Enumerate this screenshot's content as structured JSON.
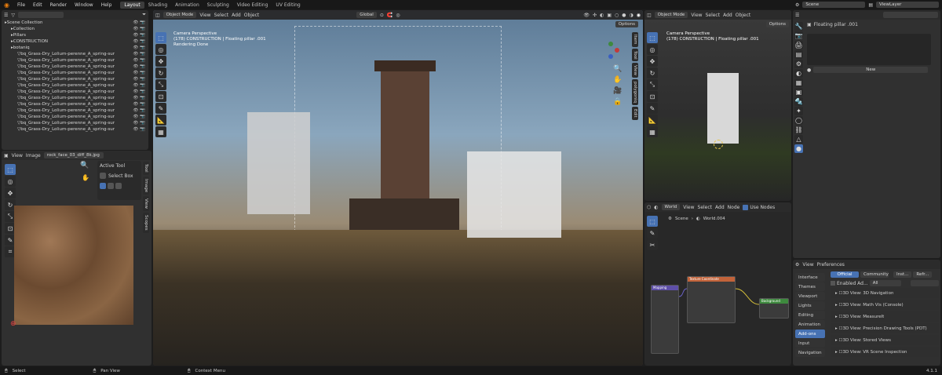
{
  "menu": [
    "File",
    "Edit",
    "Render",
    "Window",
    "Help"
  ],
  "workspaces": {
    "tabs": [
      "Layout",
      "Shading",
      "Animation",
      "Sculpting",
      "Video Editing",
      "UV Editing"
    ],
    "active_index": 0
  },
  "scene_field": "Scene",
  "viewlayer_field": "ViewLayer",
  "outliner": {
    "search_placeholder": "",
    "rows": [
      {
        "label": "Scene Collection",
        "indent": 0
      },
      {
        "label": "Collection",
        "indent": 1
      },
      {
        "label": "Pillars",
        "indent": 1
      },
      {
        "label": "CONSTRUCTION",
        "indent": 1
      },
      {
        "label": "botaniq",
        "indent": 1
      },
      {
        "label": "bq_Grass-Dry_Lolium-perenne_A_spring-summer",
        "indent": 2
      },
      {
        "label": "bq_Grass-Dry_Lolium-perenne_A_spring-summer",
        "indent": 2
      },
      {
        "label": "bq_Grass-Dry_Lolium-perenne_A_spring-summer",
        "indent": 2
      },
      {
        "label": "bq_Grass-Dry_Lolium-perenne_A_spring-summer",
        "indent": 2
      },
      {
        "label": "bq_Grass-Dry_Lolium-perenne_A_spring-summer",
        "indent": 2
      },
      {
        "label": "bq_Grass-Dry_Lolium-perenne_A_spring-summer",
        "indent": 2
      },
      {
        "label": "bq_Grass-Dry_Lolium-perenne_A_spring-summer",
        "indent": 2
      },
      {
        "label": "bq_Grass-Dry_Lolium-perenne_A_spring-summer",
        "indent": 2
      },
      {
        "label": "bq_Grass-Dry_Lolium-perenne_A_spring-summer",
        "indent": 2
      },
      {
        "label": "bq_Grass-Dry_Lolium-perenne_A_spring-summer",
        "indent": 2
      },
      {
        "label": "bq_Grass-Dry_Lolium-perenne_A_spring-summer",
        "indent": 2
      },
      {
        "label": "bq_Grass-Dry_Lolium-perenne_A_spring-summer",
        "indent": 2
      },
      {
        "label": "bq_Grass-Dry_Lolium-perenne_A_spring-summer",
        "indent": 2
      }
    ]
  },
  "image_editor": {
    "menus": [
      "View",
      "Image"
    ],
    "image_name": "rock_face_03_diff_8k.jpg",
    "active_tool_title": "Active Tool",
    "active_tool_name": "Select Box",
    "side_tabs": [
      "Tool",
      "Image",
      "View",
      "Scopes"
    ]
  },
  "viewport_main": {
    "mode": "Object Mode",
    "menus": [
      "View",
      "Select",
      "Add",
      "Object"
    ],
    "transform": "Global",
    "options": "Options",
    "overlay_line1": "Camera Perspective",
    "overlay_line2": "(178) CONSTRUCTION | Floating pillar .001",
    "overlay_line3": "Rendering Done",
    "side_tabs": [
      "Item",
      "Tool",
      "View",
      "polygoniq",
      "Edit"
    ]
  },
  "viewport_right": {
    "mode": "Object Mode",
    "menus": [
      "View",
      "Select",
      "Add",
      "Object"
    ],
    "options": "Options",
    "overlay_line1": "Camera Perspective",
    "overlay_line2": "(178) CONSTRUCTION | Floating pillar .001"
  },
  "node_editor": {
    "type": "World",
    "menus": [
      "View",
      "Select",
      "Add",
      "Node"
    ],
    "use_nodes": "Use Nodes",
    "breadcrumb_scene": "Scene",
    "breadcrumb_world": "World.004",
    "nodes": [
      {
        "title": "Mapping"
      },
      {
        "title": "Texture Coordinate"
      },
      {
        "title": "Background"
      }
    ]
  },
  "properties": {
    "object_name": "Floating pillar .001",
    "new_button": "New"
  },
  "preferences": {
    "menus": [
      "View",
      "Preferences"
    ],
    "categories": [
      "Interface",
      "Themes",
      "Viewport",
      "Lights",
      "Editing",
      "Animation",
      "Add-ons",
      "Input",
      "Navigation"
    ],
    "active_category": "Add-ons",
    "tabs": [
      "Official",
      "Community"
    ],
    "install": "Inst...",
    "refresh": "Refr...",
    "enabled_addons": "Enabled Ad...",
    "filter_all": "All",
    "addons": [
      "3D View: 3D Navigation",
      "3D View: Math Vis (Console)",
      "3D View: MeasureIt",
      "3D View: Precision Drawing Tools (PDT)",
      "3D View: Stored Views",
      "3D View: VR Scene Inspection"
    ]
  },
  "statusbar": {
    "select": "Select",
    "pan": "Pan View",
    "context": "Context Menu",
    "version": "4.1.1"
  },
  "colors": {
    "accent": "#4772b3",
    "panel": "#303030",
    "header": "#2b2b2b",
    "background": "#1d1d1d"
  }
}
